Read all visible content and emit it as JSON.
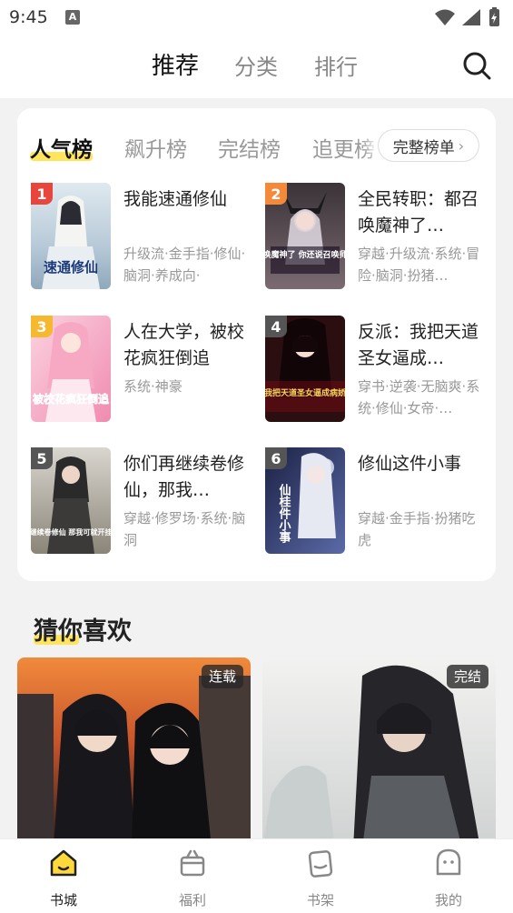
{
  "status": {
    "time": "9:45",
    "notif_icon": "A"
  },
  "top_tabs": [
    {
      "label": "推荐",
      "active": true
    },
    {
      "label": "分类",
      "active": false
    },
    {
      "label": "排行",
      "active": false
    }
  ],
  "rank": {
    "tabs": [
      {
        "label": "人气榜",
        "active": true
      },
      {
        "label": "飙升榜",
        "active": false
      },
      {
        "label": "完结榜",
        "active": false
      },
      {
        "label": "追更榜",
        "active": false
      }
    ],
    "full_list_label": "完整榜单",
    "books": [
      {
        "no": "1",
        "title": "我能速通修仙",
        "tags": "升级流·金手指·修仙·脑洞·养成向·",
        "cover_text": "速通修仙",
        "badge_color": "#e8453c"
      },
      {
        "no": "2",
        "title": "全民转职：都召唤魔神了…",
        "tags": "穿越·升级流·系统·冒险·脑洞·扮猪…",
        "cover_text": "都召唤魔神了 你还说召唤师弱？",
        "badge_color": "#f5893a"
      },
      {
        "no": "3",
        "title": "人在大学，被校花疯狂倒追",
        "tags": "系统·神豪",
        "cover_text": "被校花疯狂倒追",
        "badge_color": "#f5b82e"
      },
      {
        "no": "4",
        "title": "反派：我把天道圣女逼成…",
        "tags": "穿书·逆袭·无脑爽·系统·修仙·女帝·…",
        "cover_text": "我把天道圣女逼成病娇",
        "badge_color": "#555555"
      },
      {
        "no": "5",
        "title": "你们再继续卷修仙，那我…",
        "tags": "穿越·修罗场·系统·脑洞",
        "cover_text": "再继续卷修仙 那我可就开挂了",
        "badge_color": "#555555"
      },
      {
        "no": "6",
        "title": "修仙这件小事",
        "tags": "穿越·金手指·扮猪吃虎",
        "cover_text": "仙桂件小事",
        "badge_color": "#555555"
      }
    ]
  },
  "guess": {
    "title": "猜你喜欢",
    "cards": [
      {
        "badge": "连载"
      },
      {
        "badge": "完结"
      }
    ]
  },
  "bottom_nav": [
    {
      "label": "书城",
      "icon": "home-icon",
      "active": true
    },
    {
      "label": "福利",
      "icon": "gift-icon",
      "active": false
    },
    {
      "label": "书架",
      "icon": "bookshelf-icon",
      "active": false
    },
    {
      "label": "我的",
      "icon": "profile-icon",
      "active": false
    }
  ]
}
